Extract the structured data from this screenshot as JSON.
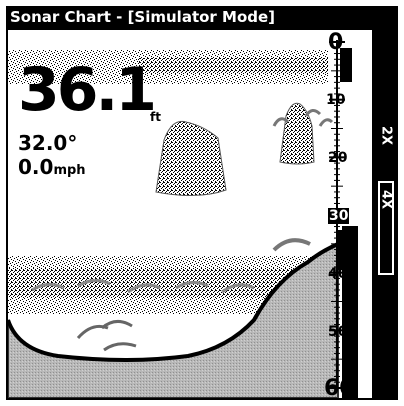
{
  "window": {
    "title": "Sonar Chart - [Simulator Mode]"
  },
  "readouts": {
    "depth_value": "36.1",
    "depth_unit": "ft",
    "temperature": "32.0°",
    "speed_value": "0.0",
    "speed_unit": "mph"
  },
  "depth_scale": {
    "labels": [
      "0",
      "10",
      "20",
      "30",
      "40",
      "50",
      "60"
    ]
  },
  "zoom_bar": {
    "zoom_2x": "2X",
    "zoom_4x": "4X"
  }
}
